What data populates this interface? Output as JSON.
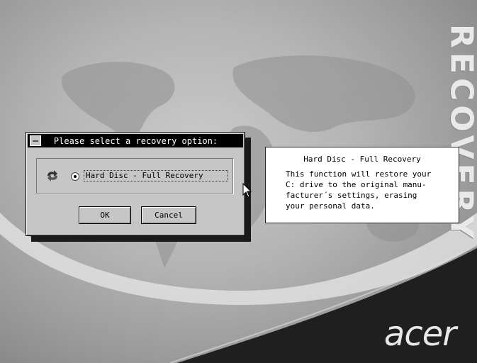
{
  "brand": {
    "vertical_text": "RECOVERY",
    "logo_text": "acer"
  },
  "dialog": {
    "title": "Please select a recovery option:",
    "options": [
      {
        "label": "Hard Disc - Full Recovery",
        "selected": true
      }
    ],
    "ok_label": "OK",
    "cancel_label": "Cancel"
  },
  "info_panel": {
    "title": "Hard Disc - Full Recovery",
    "body": "This function will restore your\nC: drive to the original manu-\nfacturer´s settings, erasing\nyour personal data."
  },
  "icons": {
    "option_icon": "recovery-arrows-icon",
    "cursor": "mouse-pointer-icon",
    "system_menu": "system-menu-icon"
  },
  "colors": {
    "titlebar": "#000000",
    "dialog_face": "#c6c6c6",
    "info_background": "#ffffff",
    "swoosh": "#1f1f1f"
  }
}
